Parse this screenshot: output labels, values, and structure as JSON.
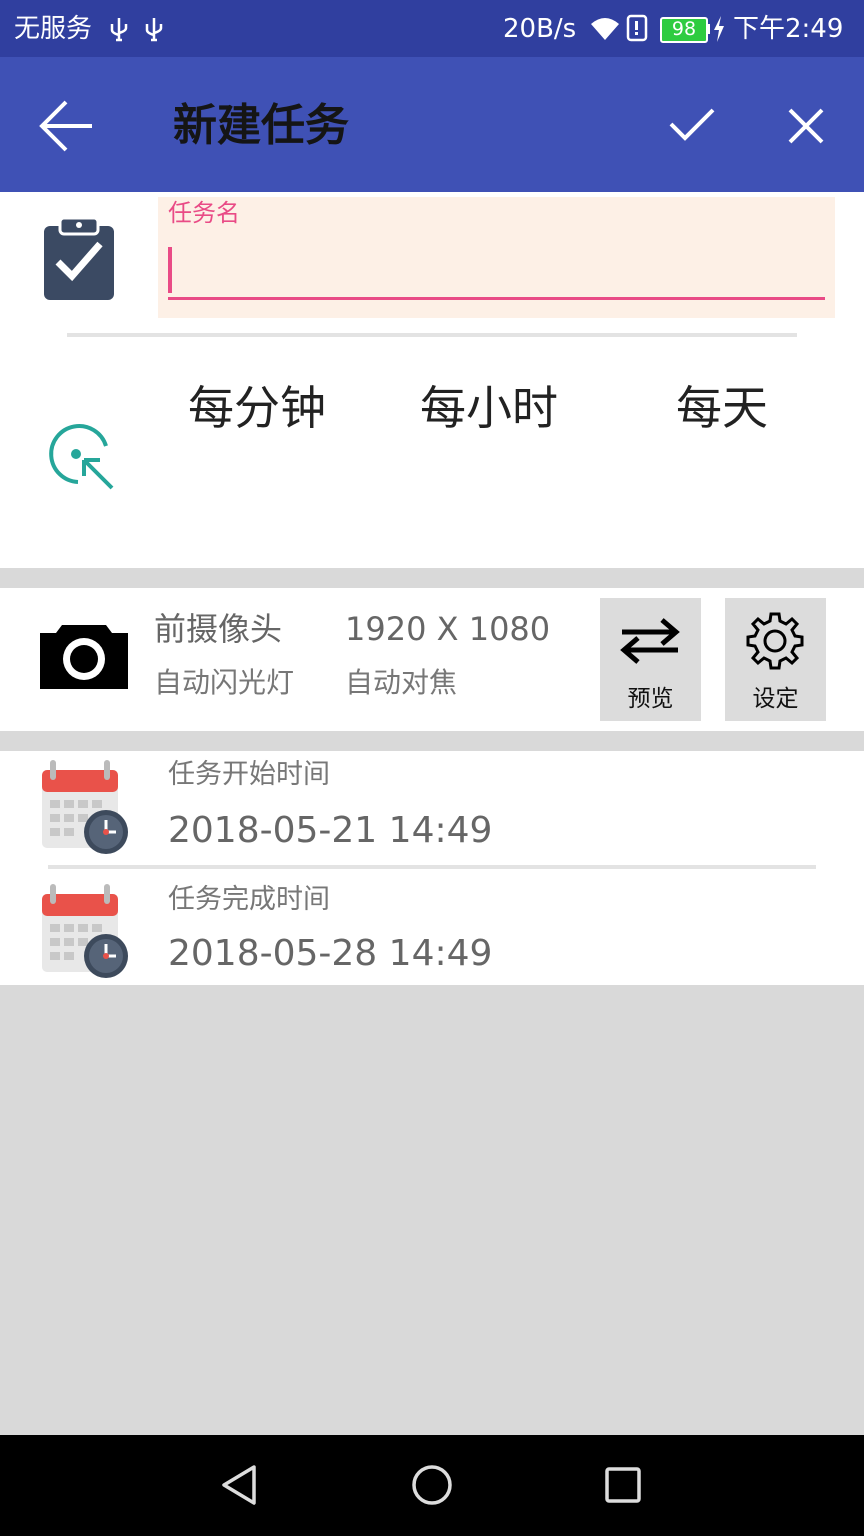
{
  "status_bar": {
    "carrier": "无服务",
    "net_speed": "20B/s",
    "battery": "98",
    "time": "下午2:49"
  },
  "app_bar": {
    "title": "新建任务",
    "icons": [
      "back-arrow-icon",
      "check-icon",
      "close-icon"
    ]
  },
  "task_name": {
    "label": "任务名",
    "value": ""
  },
  "frequency": {
    "options": [
      "每分钟",
      "每小时",
      "每天"
    ]
  },
  "camera": {
    "camera_name": "前摄像头",
    "resolution": "1920 X 1080",
    "flash": "自动闪光灯",
    "focus": "自动对焦",
    "preview_label": "预览",
    "settings_label": "设定"
  },
  "schedule": {
    "start_label": "任务开始时间",
    "start_value": "2018-05-21 14:49",
    "end_label": "任务完成时间",
    "end_value": "2018-05-28 14:49"
  },
  "colors": {
    "status_bar": "#303f9f",
    "app_bar": "#3f51b5",
    "accent": "#e94b86",
    "teal": "#26a69a"
  }
}
